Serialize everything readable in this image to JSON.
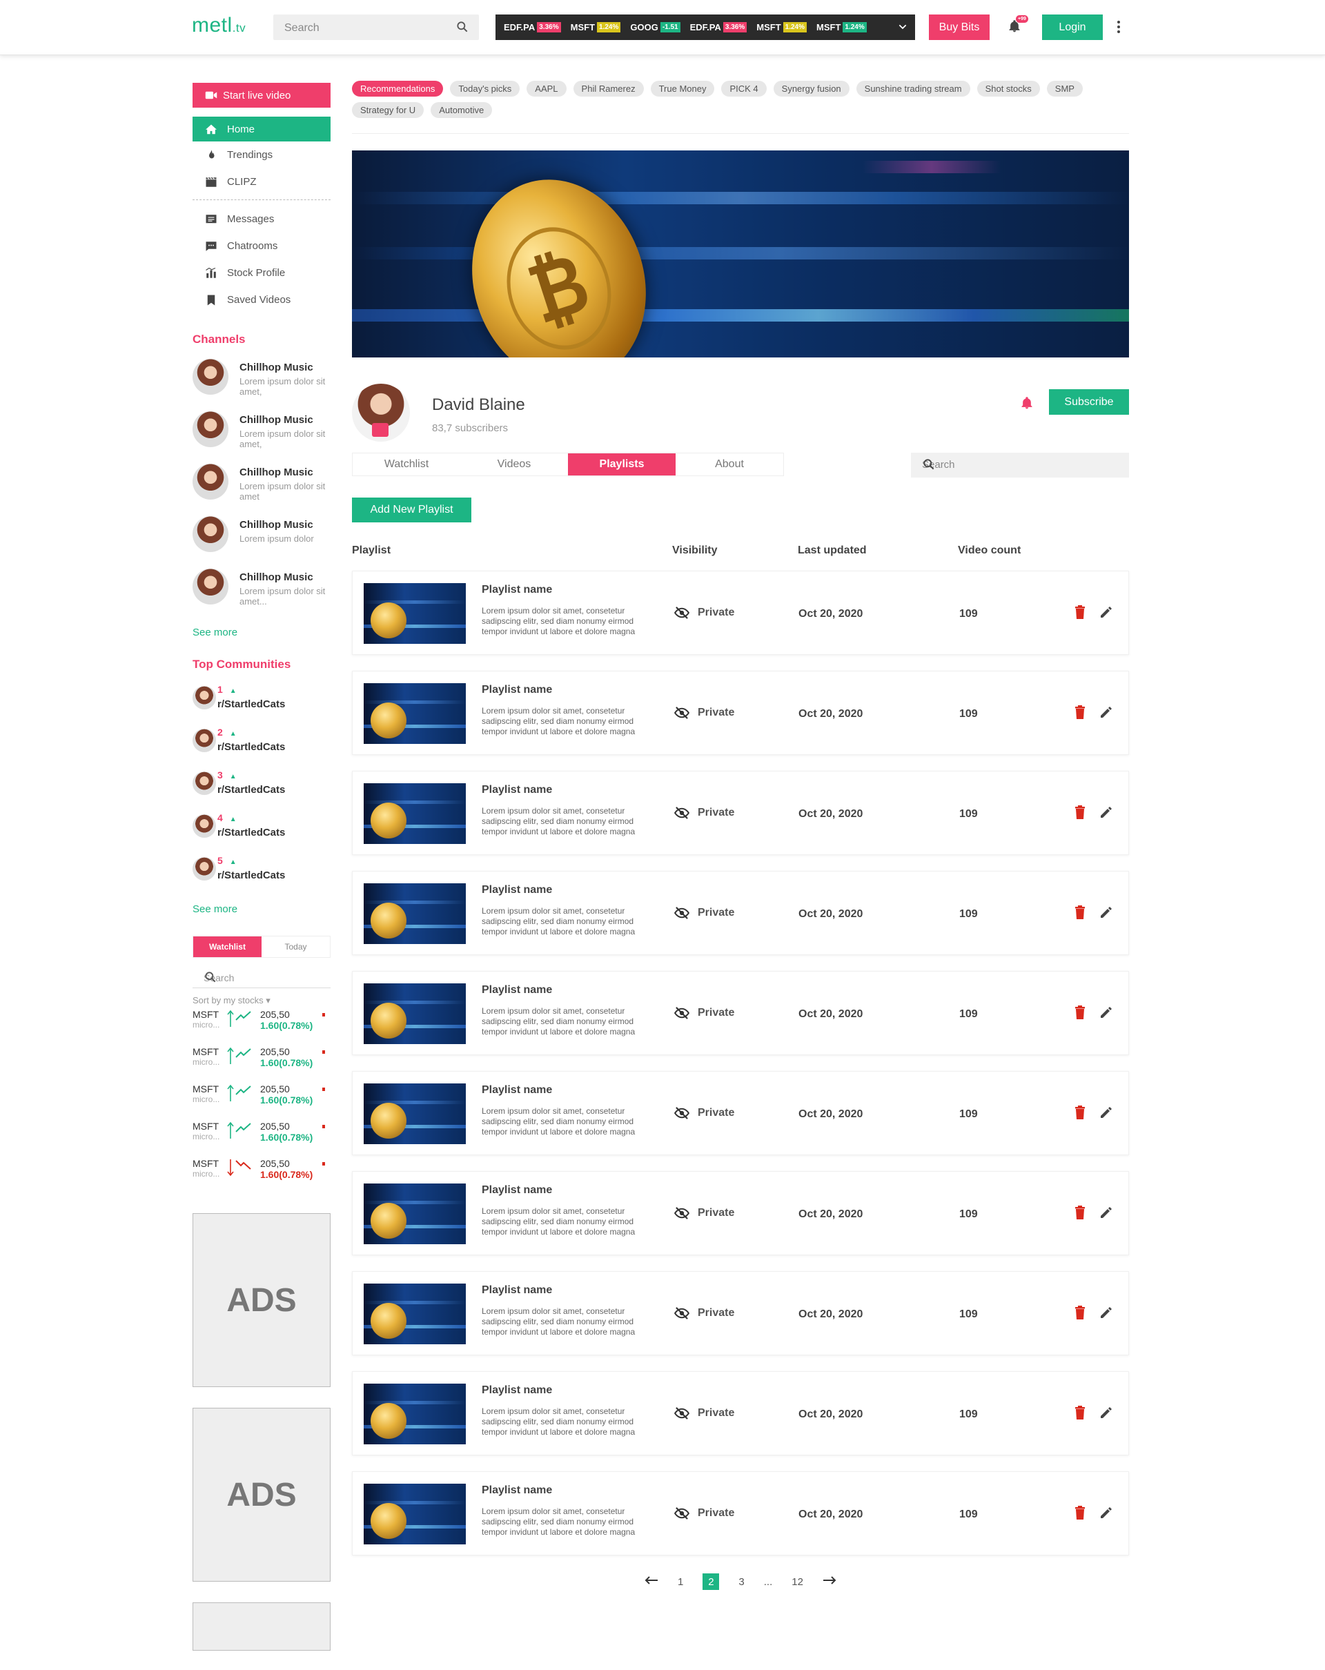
{
  "header": {
    "logo_main": "metl",
    "logo_suffix": ".tv",
    "search_placeholder": "Search",
    "ticker": [
      {
        "symbol": "EDF.PA",
        "change": "3.36%",
        "color": "#ef3e6b"
      },
      {
        "symbol": "MSFT",
        "change": "1.24%",
        "color": "#d9c51c"
      },
      {
        "symbol": "GOOG",
        "change": "-1.51",
        "color": "#1db584"
      },
      {
        "symbol": "EDF.PA",
        "change": "3.36%",
        "color": "#ef3e6b"
      },
      {
        "symbol": "MSFT",
        "change": "1.24%",
        "color": "#d9c51c"
      },
      {
        "symbol": "MSFT",
        "change": "1.24%",
        "color": "#1db584"
      }
    ],
    "buy_bits": "Buy Bits",
    "notif_badge": "+99",
    "login": "Login"
  },
  "sidebar": {
    "start_live": "Start live video",
    "home": "Home",
    "nav_top": [
      "Trendings",
      "CLIPZ"
    ],
    "nav_bottom": [
      "Messages",
      "Chatrooms",
      "Stock Profile",
      "Saved Videos"
    ],
    "channels_title": "Channels",
    "channels": [
      {
        "name": "Chillhop Music",
        "desc": "Lorem ipsum dolor sit amet,"
      },
      {
        "name": "Chillhop Music",
        "desc": "Lorem ipsum dolor sit amet,"
      },
      {
        "name": "Chillhop Music",
        "desc": "Lorem ipsum dolor sit amet"
      },
      {
        "name": "Chillhop Music",
        "desc": "Lorem ipsum dolor"
      },
      {
        "name": "Chillhop Music",
        "desc": "Lorem ipsum dolor sit amet..."
      }
    ],
    "see_more": "See more",
    "communities_title": "Top Communities",
    "communities": [
      {
        "rank": "1",
        "name": "r/StartledCats"
      },
      {
        "rank": "2",
        "name": "r/StartledCats"
      },
      {
        "rank": "3",
        "name": "r/StartledCats"
      },
      {
        "rank": "4",
        "name": "r/StartledCats"
      },
      {
        "rank": "5",
        "name": "r/StartledCats"
      }
    ],
    "see_more_2": "See more",
    "watchlist_tab": "Watchlist",
    "today_tab": "Today",
    "wl_search": "Search",
    "sort_by": "Sort by my stocks",
    "stocks": [
      {
        "symbol": "MSFT",
        "sub": "micro...",
        "price": "205,50",
        "change": "1.60(0.78%)",
        "trend": "up"
      },
      {
        "symbol": "MSFT",
        "sub": "micro...",
        "price": "205,50",
        "change": "1.60(0.78%)",
        "trend": "up"
      },
      {
        "symbol": "MSFT",
        "sub": "micro...",
        "price": "205,50",
        "change": "1.60(0.78%)",
        "trend": "up"
      },
      {
        "symbol": "MSFT",
        "sub": "micro...",
        "price": "205,50",
        "change": "1.60(0.78%)",
        "trend": "up"
      },
      {
        "symbol": "MSFT",
        "sub": "micro...",
        "price": "205,50",
        "change": "1.60(0.78%)",
        "trend": "down"
      }
    ],
    "ads": [
      "ADS",
      "ADS"
    ]
  },
  "main": {
    "chips": [
      "Recommendations",
      "Today's picks",
      "AAPL",
      "Phil Ramerez",
      "True Money",
      "PICK 4",
      "Synergy fusion",
      "Sunshine trading stream",
      "Shot stocks",
      "SMP",
      "Strategy for U",
      "Automotive"
    ],
    "profile": {
      "name": "David Blaine",
      "subscribers": "83,7 subscribers",
      "subscribe": "Subscribe"
    },
    "tabs": [
      "Watchlist",
      "Videos",
      "Playlists",
      "About"
    ],
    "active_tab": "Playlists",
    "search_placeholder": "Search",
    "add_playlist": "Add New Playlist",
    "columns": [
      "Playlist",
      "Visibility",
      "Last updated",
      "Video count"
    ],
    "playlists": [
      {
        "name": "Playlist name",
        "desc": "Lorem ipsum dolor sit amet, consetetur sadipscing elitr, sed diam nonumy eirmod tempor invidunt ut labore et dolore magna",
        "visibility": "Private",
        "updated": "Oct 20, 2020",
        "count": "109"
      },
      {
        "name": "Playlist name",
        "desc": "Lorem ipsum dolor sit amet, consetetur sadipscing elitr, sed diam nonumy eirmod tempor invidunt ut labore et dolore magna",
        "visibility": "Private",
        "updated": "Oct 20, 2020",
        "count": "109"
      },
      {
        "name": "Playlist name",
        "desc": "Lorem ipsum dolor sit amet, consetetur sadipscing elitr, sed diam nonumy eirmod tempor invidunt ut labore et dolore magna",
        "visibility": "Private",
        "updated": "Oct 20, 2020",
        "count": "109"
      },
      {
        "name": "Playlist name",
        "desc": "Lorem ipsum dolor sit amet, consetetur sadipscing elitr, sed diam nonumy eirmod tempor invidunt ut labore et dolore magna",
        "visibility": "Private",
        "updated": "Oct 20, 2020",
        "count": "109"
      },
      {
        "name": "Playlist name",
        "desc": "Lorem ipsum dolor sit amet, consetetur sadipscing elitr, sed diam nonumy eirmod tempor invidunt ut labore et dolore magna",
        "visibility": "Private",
        "updated": "Oct 20, 2020",
        "count": "109"
      },
      {
        "name": "Playlist name",
        "desc": "Lorem ipsum dolor sit amet, consetetur sadipscing elitr, sed diam nonumy eirmod tempor invidunt ut labore et dolore magna",
        "visibility": "Private",
        "updated": "Oct 20, 2020",
        "count": "109"
      },
      {
        "name": "Playlist name",
        "desc": "Lorem ipsum dolor sit amet, consetetur sadipscing elitr, sed diam nonumy eirmod tempor invidunt ut labore et dolore magna",
        "visibility": "Private",
        "updated": "Oct 20, 2020",
        "count": "109"
      },
      {
        "name": "Playlist name",
        "desc": "Lorem ipsum dolor sit amet, consetetur sadipscing elitr, sed diam nonumy eirmod tempor invidunt ut labore et dolore magna",
        "visibility": "Private",
        "updated": "Oct 20, 2020",
        "count": "109"
      },
      {
        "name": "Playlist name",
        "desc": "Lorem ipsum dolor sit amet, consetetur sadipscing elitr, sed diam nonumy eirmod tempor invidunt ut labore et dolore magna",
        "visibility": "Private",
        "updated": "Oct 20, 2020",
        "count": "109"
      },
      {
        "name": "Playlist name",
        "desc": "Lorem ipsum dolor sit amet, consetetur sadipscing elitr, sed diam nonumy eirmod tempor invidunt ut labore et dolore magna",
        "visibility": "Private",
        "updated": "Oct 20, 2020",
        "count": "109"
      }
    ],
    "pagination": {
      "pages": [
        "1",
        "2",
        "3",
        "...",
        "12"
      ],
      "current": "2"
    }
  },
  "colors": {
    "accent_pink": "#ef3e6b",
    "accent_green": "#1db584",
    "danger_red": "#d9291c"
  },
  "icons": [
    "search-icon",
    "chevron-down-icon",
    "bell-icon",
    "kebab-menu-icon",
    "video-camera-icon",
    "home-icon",
    "fire-icon",
    "clapperboard-icon",
    "messages-icon",
    "chat-icon",
    "stock-chart-icon",
    "bookmark-icon",
    "eye-off-icon",
    "trash-icon",
    "pencil-icon",
    "arrow-left-icon",
    "arrow-right-icon"
  ]
}
